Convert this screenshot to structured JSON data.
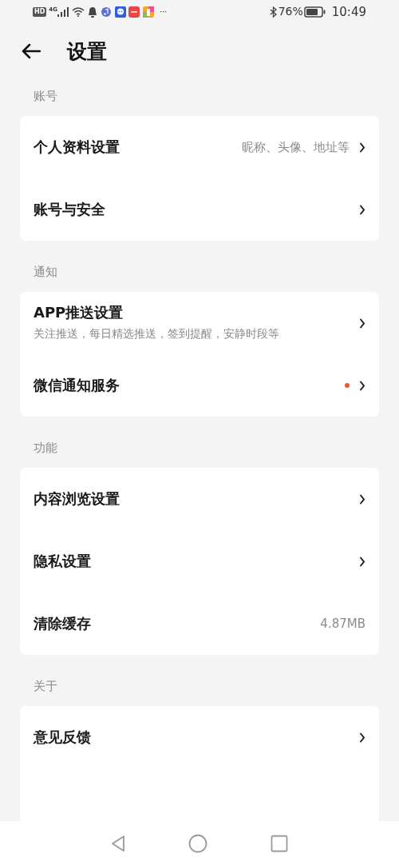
{
  "status_bar": {
    "hd": "HD",
    "network": "4G",
    "more": "···",
    "battery": "76%",
    "time": "10:49"
  },
  "header": {
    "title": "设置"
  },
  "sections": [
    {
      "label": "账号",
      "items": [
        {
          "title": "个人资料设置",
          "value": "昵称、头像、地址等",
          "chevron": true,
          "dot": false
        },
        {
          "title": "账号与安全",
          "chevron": true,
          "dot": false
        }
      ]
    },
    {
      "label": "通知",
      "items": [
        {
          "title": "APP推送设置",
          "subtitle": "关注推送，每日精选推送，签到提醒，安静时段等",
          "chevron": true,
          "dot": false
        },
        {
          "title": "微信通知服务",
          "chevron": true,
          "dot": true
        }
      ]
    },
    {
      "label": "功能",
      "items": [
        {
          "title": "内容浏览设置",
          "chevron": true,
          "dot": false
        },
        {
          "title": "隐私设置",
          "chevron": true,
          "dot": false
        },
        {
          "title": "清除缓存",
          "value": "4.87MB",
          "chevron": false,
          "dot": false
        }
      ]
    },
    {
      "label": "关于",
      "items": [
        {
          "title": "意见反馈",
          "chevron": true,
          "dot": false
        }
      ]
    }
  ]
}
